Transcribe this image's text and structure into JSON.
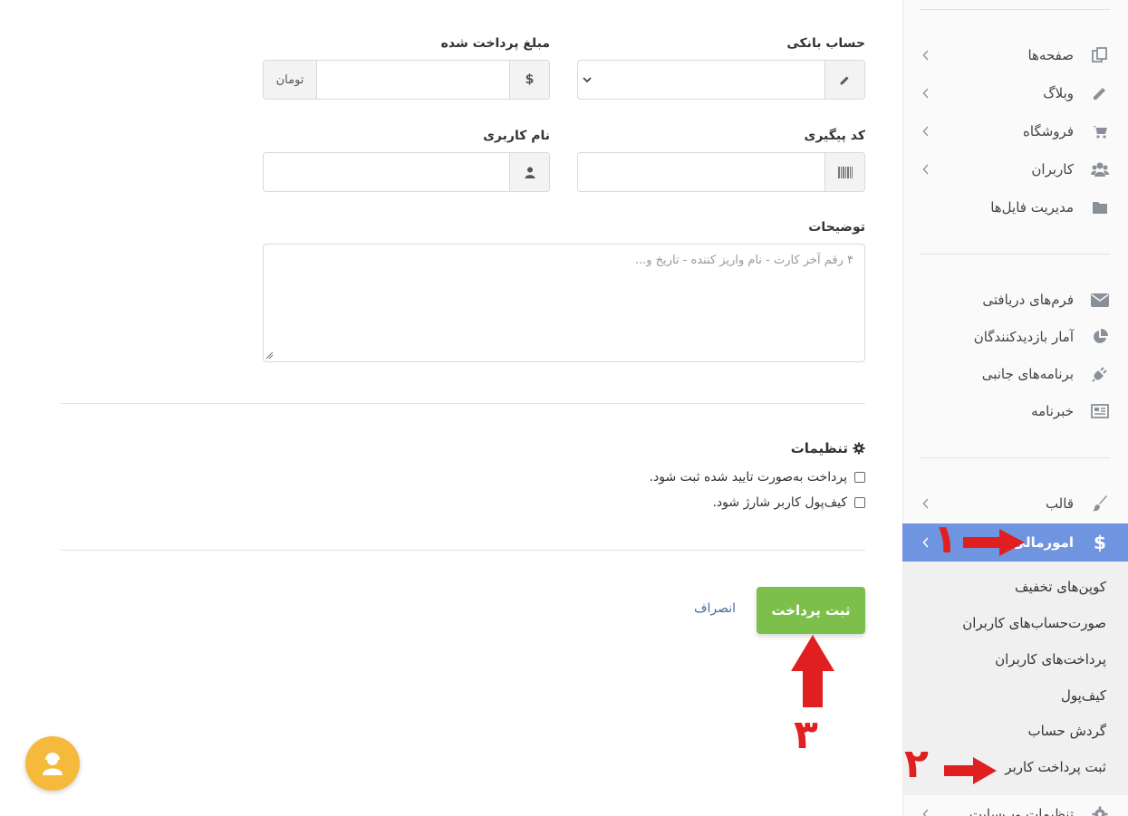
{
  "form": {
    "bank_account_label": "حساب بانکی",
    "amount_label": "مبلغ پرداخت شده",
    "currency_symbol": "$",
    "currency_unit": "تومان",
    "tracking_code_label": "کد پیگیری",
    "username_label": "نام کاربری",
    "description_label": "توضیحات",
    "description_placeholder": "۴ رقم آخر کارت - نام واریز کننده - تاریخ و...",
    "settings_title": "تنظیمات",
    "option_confirmed": "پرداخت به‌صورت تایید شده ثبت شود.",
    "option_wallet": "کیف‌پول کاربر شارژ شود.",
    "submit_label": "ثبت پرداخت",
    "cancel_label": "انصراف"
  },
  "sidebar": {
    "items": [
      {
        "label": "صفحه‌ها",
        "icon": "pages-icon"
      },
      {
        "label": "وبلاگ",
        "icon": "pencil-icon"
      },
      {
        "label": "فروشگاه",
        "icon": "cart-icon"
      },
      {
        "label": "کاربران",
        "icon": "users-icon"
      },
      {
        "label": "مدیریت فایل‌ها",
        "icon": "folder-icon"
      },
      {
        "label": "فرم‌های دریافتی",
        "icon": "envelope-icon"
      },
      {
        "label": "آمار بازدیدکنندگان",
        "icon": "pie-chart-icon"
      },
      {
        "label": "برنامه‌های جانبی",
        "icon": "plug-icon"
      },
      {
        "label": "خبرنامه",
        "icon": "newspaper-icon"
      },
      {
        "label": "قالب",
        "icon": "brush-icon"
      },
      {
        "label": "امورمالی",
        "icon": "dollar-icon"
      },
      {
        "label": "تنظیمات وب‌سایت",
        "icon": "gear-icon"
      }
    ],
    "finance_submenu": [
      "کوپن‌های تخفیف",
      "صورت‌حساب‌های کاربران",
      "پرداخت‌های کاربران",
      "کیف‌پول",
      "گردش حساب",
      "ثبت پرداخت کاربر"
    ]
  },
  "annotations": {
    "step1": "۱",
    "step2": "۲",
    "step3": "۳",
    "arrow_color": "#e02020"
  },
  "colors": {
    "active_menu": "#6f95e0",
    "submit_button": "#7cbf4a",
    "support_fab": "#f5b93b"
  }
}
